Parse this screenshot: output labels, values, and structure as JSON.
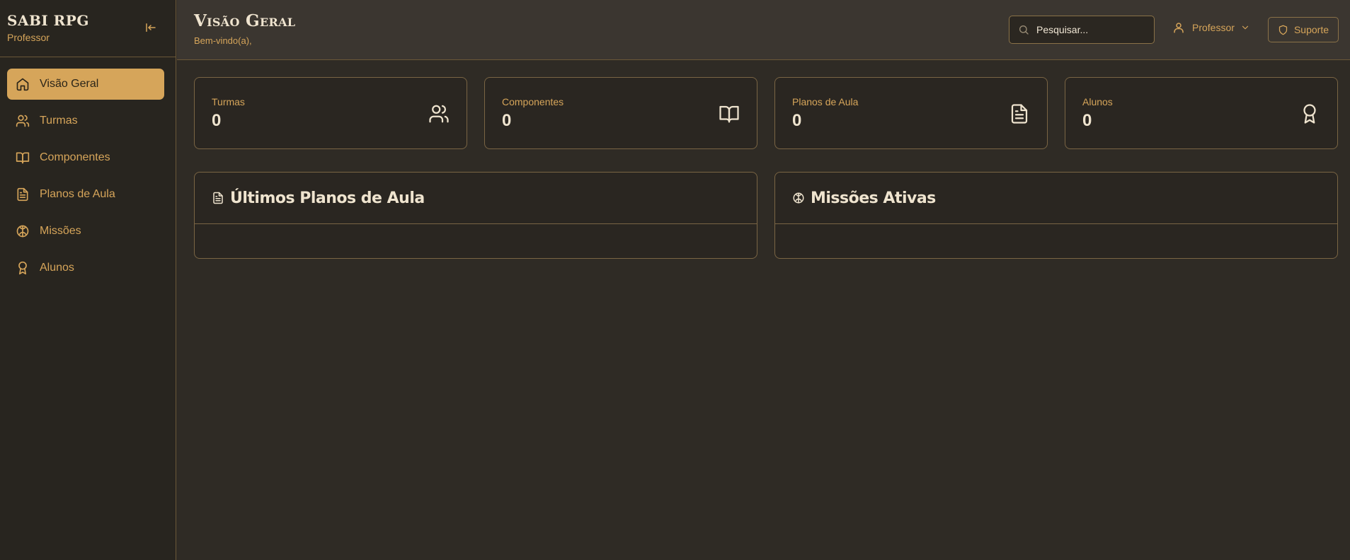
{
  "sidebar": {
    "brand_title": "SABI RPG",
    "brand_subtitle": "Professor",
    "items": [
      {
        "label": "Visão Geral",
        "icon": "home-icon",
        "active": true
      },
      {
        "label": "Turmas",
        "icon": "users-icon"
      },
      {
        "label": "Componentes",
        "icon": "book-icon"
      },
      {
        "label": "Planos de Aula",
        "icon": "file-text-icon"
      },
      {
        "label": "Missões",
        "icon": "brain-icon"
      },
      {
        "label": "Alunos",
        "icon": "award-icon"
      }
    ]
  },
  "header": {
    "title": "Visão Geral",
    "subtitle": "Bem-vindo(a),",
    "search_placeholder": "Pesquisar...",
    "user_label": "Professor",
    "support_label": "Suporte"
  },
  "stats": [
    {
      "label": "Turmas",
      "value": "0",
      "icon": "users-icon"
    },
    {
      "label": "Componentes",
      "value": "0",
      "icon": "book-icon"
    },
    {
      "label": "Planos de Aula",
      "value": "0",
      "icon": "file-text-icon"
    },
    {
      "label": "Alunos",
      "value": "0",
      "icon": "award-icon"
    }
  ],
  "panels": {
    "latest_plans_title": "Últimos Planos de Aula",
    "active_missions_title": "Missões Ativas"
  },
  "colors": {
    "accent": "#d6a55a",
    "background": "#2f2b25",
    "text_light": "#efe4cf"
  }
}
